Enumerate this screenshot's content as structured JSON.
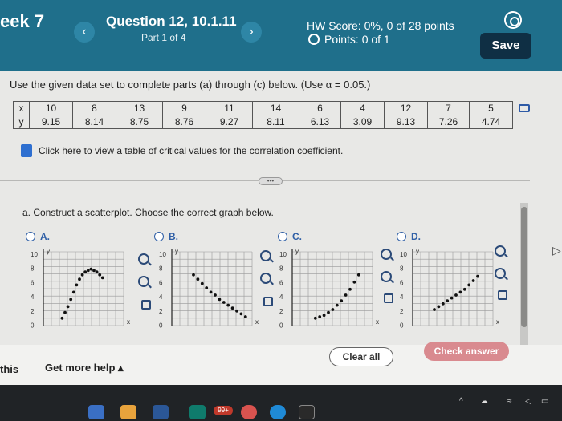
{
  "header": {
    "week": "eek 7",
    "question_title": "Question 12, 10.1.11",
    "part": "Part 1 of 4",
    "hw_score": "HW Score: 0%, 0 of 28 points",
    "points": "Points: 0 of 1",
    "prev": "‹",
    "next": "›",
    "save_label": "Save"
  },
  "instructions": "Use the given data set to complete parts (a) through (c) below. (Use α = 0.05.)",
  "table": {
    "x_label": "x",
    "y_label": "y",
    "x": [
      "10",
      "8",
      "13",
      "9",
      "11",
      "14",
      "6",
      "4",
      "12",
      "7",
      "5"
    ],
    "y": [
      "9.15",
      "8.14",
      "8.75",
      "8.76",
      "9.27",
      "8.11",
      "6.13",
      "3.09",
      "9.13",
      "7.26",
      "4.74"
    ]
  },
  "critical_link": "Click here to view a table of critical values for the correlation coefficient.",
  "expand_dots": "•••",
  "part_a": "a. Construct a scatterplot. Choose the correct graph below.",
  "options": [
    {
      "label": "A."
    },
    {
      "label": "B."
    },
    {
      "label": "C."
    },
    {
      "label": "D."
    }
  ],
  "graph_axes": {
    "y_name": "y",
    "x_name": "x",
    "ticks": [
      "10",
      "8",
      "6",
      "4",
      "2",
      "0"
    ]
  },
  "footer": {
    "this_label": "this",
    "get_more_help": "Get more help ▴",
    "clear_all": "Clear all",
    "check_answer": "Check answer"
  },
  "taskbar": {
    "badge": "99+"
  },
  "colors": {
    "header": "#1f6f8b",
    "save": "#0f2f44",
    "check_answer": "#d98a8f",
    "link_blue": "#2f5fa6"
  }
}
